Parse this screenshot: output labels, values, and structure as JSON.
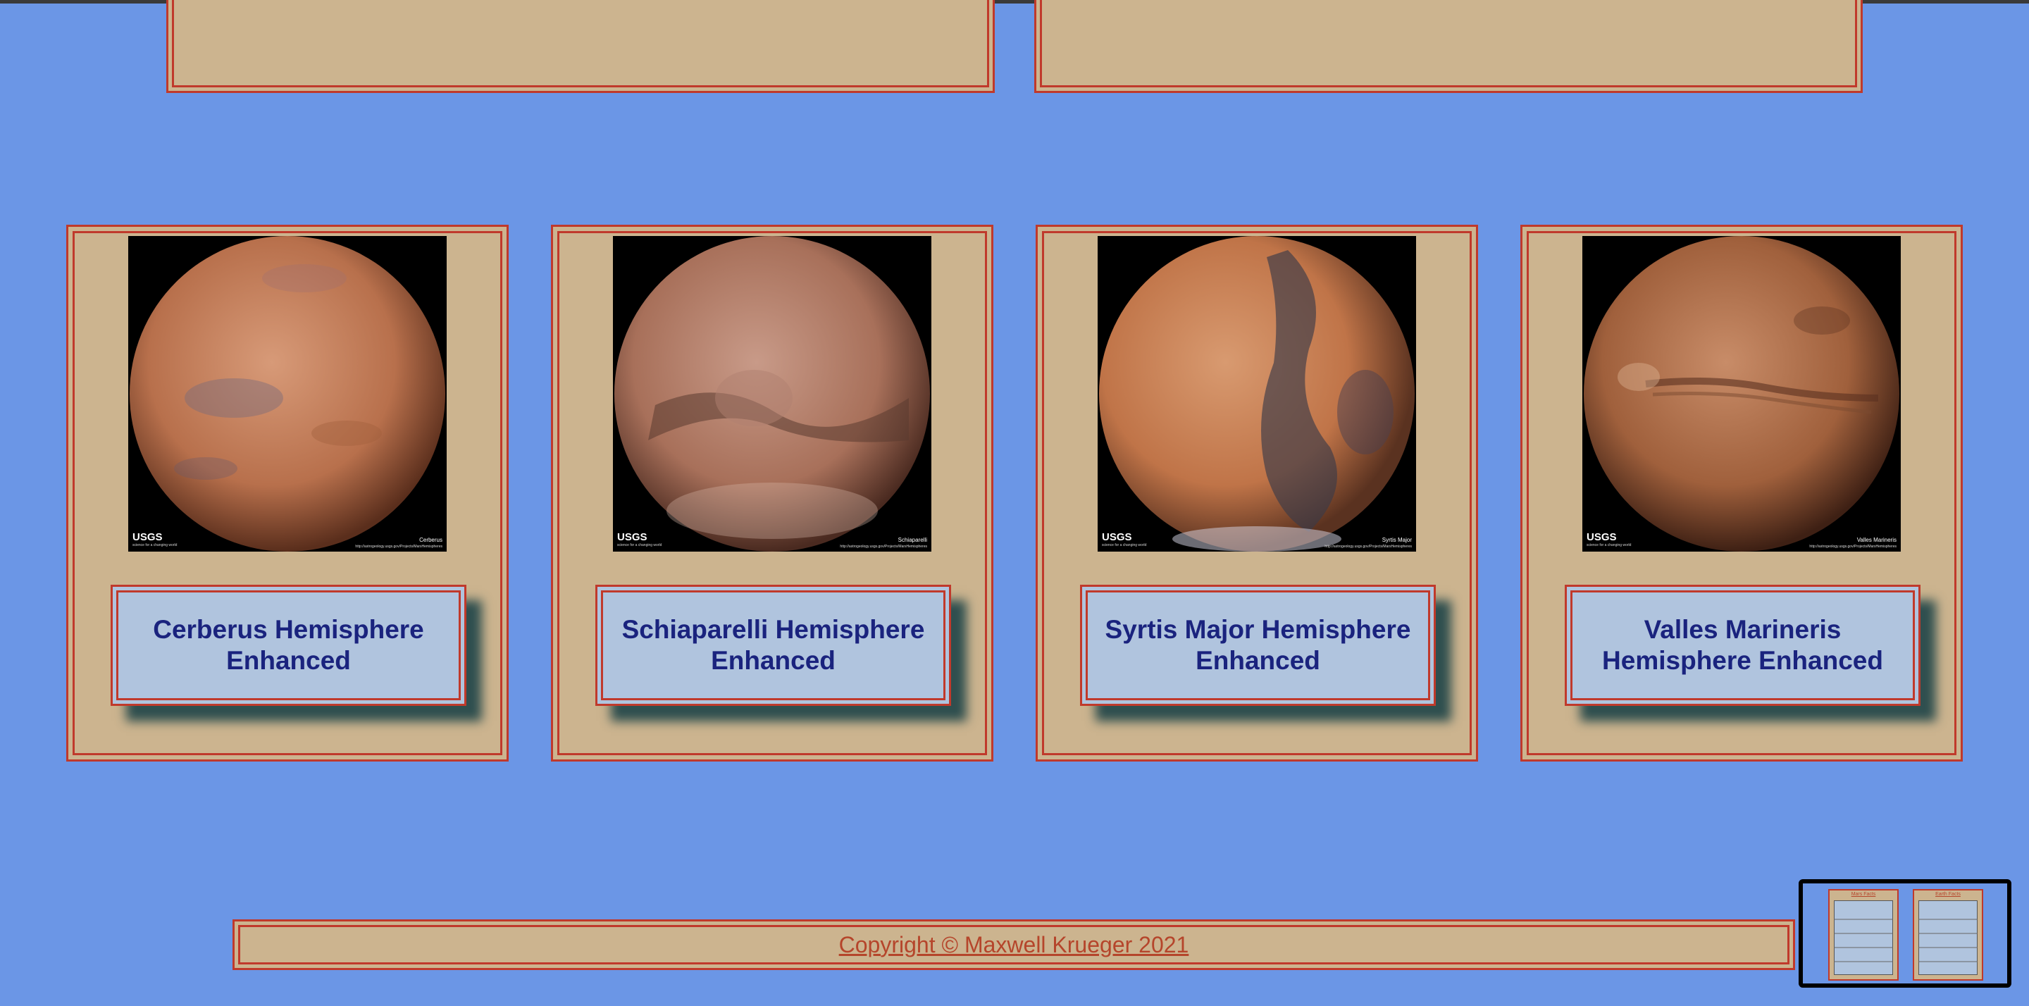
{
  "cards": [
    {
      "title": "Cerberus Hemisphere Enhanced",
      "image_caption": "Cerberus",
      "logo": "USGS",
      "url_text": "http://astrogeology.usgs.gov/Projects/MarsHemispheres"
    },
    {
      "title": "Schiaparelli Hemisphere Enhanced",
      "image_caption": "Schiaparelli",
      "logo": "USGS",
      "url_text": "http://astrogeology.usgs.gov/Projects/MarsHemispheres"
    },
    {
      "title": "Syrtis Major Hemisphere Enhanced",
      "image_caption": "Syrtis Major",
      "logo": "USGS",
      "url_text": "http://astrogeology.usgs.gov/Projects/MarsHemispheres"
    },
    {
      "title": "Valles Marineris Hemisphere Enhanced",
      "image_caption": "Valles Marineris",
      "logo": "USGS",
      "url_text": "http://astrogeology.usgs.gov/Projects/MarsHemispheres"
    }
  ],
  "footer": {
    "copyright": "Copyright © Maxwell Krueger 2021"
  },
  "colors": {
    "background": "#6b96e6",
    "card": "#ccb48f",
    "border": "#c0392b",
    "title_box": "#b0c4de",
    "title_text": "#1a237e",
    "footer_link": "#b5452b"
  },
  "icons": {
    "minimap": "page-minimap"
  }
}
